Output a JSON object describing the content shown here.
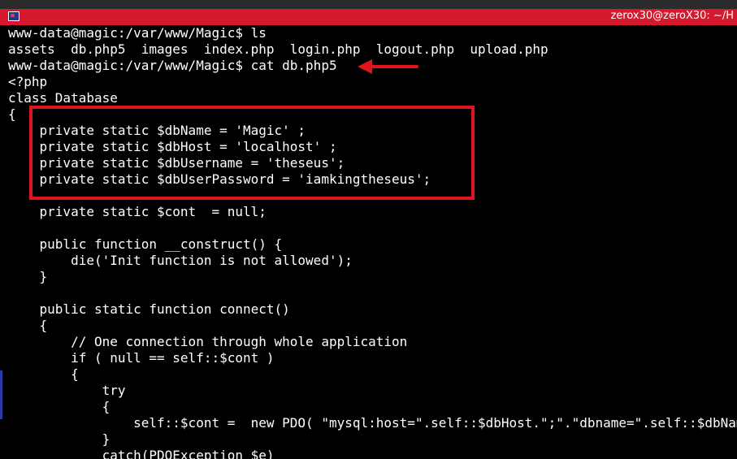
{
  "window": {
    "title": "zerox30@zeroX30: ~/H",
    "accent": "#d7192d"
  },
  "terminal": {
    "lines": [
      "www-data@magic:/var/www/Magic$ ls",
      "assets  db.php5  images  index.php  login.php  logout.php  upload.php",
      "www-data@magic:/var/www/Magic$ cat db.php5",
      "<?php",
      "class Database",
      "{",
      "    private static $dbName = 'Magic' ;",
      "    private static $dbHost = 'localhost' ;",
      "    private static $dbUsername = 'theseus';",
      "    private static $dbUserPassword = 'iamkingtheseus';",
      "",
      "    private static $cont  = null;",
      "",
      "    public function __construct() {",
      "        die('Init function is not allowed');",
      "    }",
      "",
      "    public static function connect()",
      "    {",
      "        // One connection through whole application",
      "        if ( null == self::$cont )",
      "        {",
      "            try",
      "            {",
      "                self::$cont =  new PDO( \"mysql:host=\".self::$dbHost.\";\".\"dbname=\".self::$dbName",
      "            }",
      "            catch(PDOException $e)"
    ]
  },
  "annotations": {
    "highlight_color": "#e0141d",
    "arrow_icon": "left-arrow-icon",
    "box": "credentials-highlight-box"
  }
}
